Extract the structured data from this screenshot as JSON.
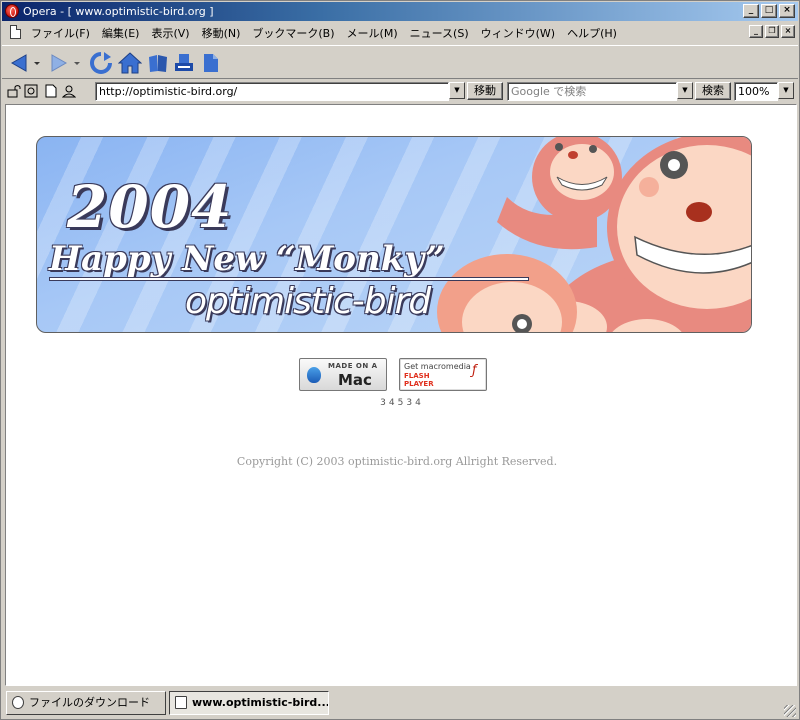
{
  "window": {
    "title": "Opera - [ www.optimistic-bird.org ]",
    "controls": {
      "minimize": "_",
      "maximize": "□",
      "close": "×",
      "restore": "❐"
    }
  },
  "menubar": {
    "items": [
      "ファイル(F)",
      "編集(E)",
      "表示(V)",
      "移動(N)",
      "ブックマーク(B)",
      "メール(M)",
      "ニュース(S)",
      "ウィンドウ(W)",
      "ヘルプ(H)"
    ]
  },
  "toolbar": {
    "icons": [
      "back-icon",
      "back-menu-icon",
      "forward-icon",
      "forward-menu-icon",
      "reload-icon",
      "home-icon",
      "hotlist-icon",
      "print-icon",
      "new-page-icon"
    ]
  },
  "addressbar": {
    "url": "http://optimistic-bird.org/",
    "go_label": "移動",
    "search_placeholder": "Google で検索",
    "search_label": "検索",
    "zoom": "100%"
  },
  "page": {
    "banner": {
      "year": "2004",
      "headline": "Happy New “Monky”",
      "site": "optimistic-bird"
    },
    "badge_mac": {
      "small": "MADE ON A",
      "big": "Mac"
    },
    "badge_flash": {
      "line1": "Get macromedia",
      "line2": "FLASH",
      "line3": "PLAYER"
    },
    "counter": "34534",
    "copyright": "Copyright (C) 2003 optimistic-bird.org Allright Reserved."
  },
  "statusbar": {
    "downloads": "ファイルのダウンロード",
    "tab": "www.optimistic-bird...."
  },
  "colors": {
    "titlebar_start": "#0a246a",
    "titlebar_end": "#a6caf0",
    "chrome": "#d4d0c8",
    "banner_blue": "#a7c8f6",
    "monkey": "#e88a80"
  }
}
